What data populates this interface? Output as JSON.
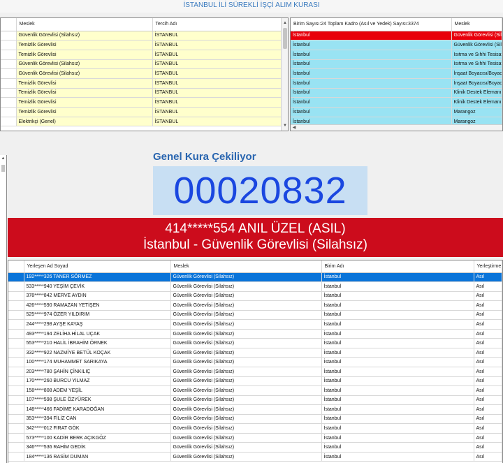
{
  "window_title": "İSTANBUL İLİ SÜREKLİ İŞÇİ ALIM KURASI",
  "top_left": {
    "columns": [
      "Meslek",
      "Tercih Adı"
    ],
    "rows": [
      [
        "Güvenlik Görevlisi (Silahsız)",
        "İSTANBUL"
      ],
      [
        "Temizlik Görevlisi",
        "İSTANBUL"
      ],
      [
        "Temizlik Görevlisi",
        "İSTANBUL"
      ],
      [
        "Güvenlik Görevlisi (Silahsız)",
        "İSTANBUL"
      ],
      [
        "Güvenlik Görevlisi (Silahsız)",
        "İSTANBUL"
      ],
      [
        "Temizlik Görevlisi",
        "İSTANBUL"
      ],
      [
        "Temizlik Görevlisi",
        "İSTANBUL"
      ],
      [
        "Temizlik Görevlisi",
        "İSTANBUL"
      ],
      [
        "Temizlik Görevlisi",
        "İSTANBUL"
      ],
      [
        "Elektrikçi (Genel)",
        "İSTANBUL"
      ]
    ]
  },
  "top_right": {
    "columns": [
      "Birim Sayısı:24 Toplam Kadro (Asıl ve Yedek) Sayısı:3374",
      "Meslek"
    ],
    "rows": [
      [
        "İstanbul",
        "Güvenlik Görevlisi (Silahsız)"
      ],
      [
        "İstanbul",
        "Güvenlik Görevlisi (Silahsız)"
      ],
      [
        "İstanbul",
        "Isıtma ve Sıhhi Tesisatçı"
      ],
      [
        "İstanbul",
        "Isıtma ve Sıhhi Tesisatçı"
      ],
      [
        "İstanbul",
        "İnşaat Boyacısı/Boyacı"
      ],
      [
        "İstanbul",
        "İnşaat Boyacısı/Boyacı"
      ],
      [
        "İstanbul",
        "Klinik Destek Elemanı (Hasta Kabul)"
      ],
      [
        "İstanbul",
        "Klinik Destek Elemanı (Hasta Kabul)"
      ],
      [
        "İstanbul",
        "Marangoz"
      ],
      [
        "İstanbul",
        "Marangoz"
      ]
    ]
  },
  "draw": {
    "label": "Genel Kura Çekiliyor",
    "number": "00020832",
    "winner_line1": "414*****554 ANIL ÜZEL (ASIL)",
    "winner_line2": "İstanbul - Güvenlik Görevlisi (Silahsız)"
  },
  "bottom_grid": {
    "columns": [
      "Yerleşen Ad Soyad",
      "Meslek",
      "Birim Adı",
      "Yerleştirme Türü"
    ],
    "rows": [
      [
        "192*****326 TANER SÖRMEZ",
        "Güvenlik Görevlisi (Silahsız)",
        "İstanbul",
        "Asıl"
      ],
      [
        "533*****940 YEŞİM ÇEVİK",
        "Güvenlik Görevlisi (Silahsız)",
        "İstanbul",
        "Asıl"
      ],
      [
        "378*****842 MERVE AYDIN",
        "Güvenlik Görevlisi (Silahsız)",
        "İstanbul",
        "Asıl"
      ],
      [
        "426*****590 RAMAZAN YETİŞEN",
        "Güvenlik Görevlisi (Silahsız)",
        "İstanbul",
        "Asıl"
      ],
      [
        "525*****974 ÖZER YILDIRIM",
        "Güvenlik Görevlisi (Silahsız)",
        "İstanbul",
        "Asıl"
      ],
      [
        "244*****298 AYŞE KAYAŞ",
        "Güvenlik Görevlisi (Silahsız)",
        "İstanbul",
        "Asıl"
      ],
      [
        "493*****194 ZELİHA HİLAL UÇAK",
        "Güvenlik Görevlisi (Silahsız)",
        "İstanbul",
        "Asıl"
      ],
      [
        "553*****210 HALİL İBRAHİM ÖRNEK",
        "Güvenlik Görevlisi (Silahsız)",
        "İstanbul",
        "Asıl"
      ],
      [
        "332*****922 NAZMİYE BETÜL KOÇAK",
        "Güvenlik Görevlisi (Silahsız)",
        "İstanbul",
        "Asıl"
      ],
      [
        "100*****174 MUHAMMET SARIKAYA",
        "Güvenlik Görevlisi (Silahsız)",
        "İstanbul",
        "Asıl"
      ],
      [
        "203*****780 ŞAHİN ÇİNKILIÇ",
        "Güvenlik Görevlisi (Silahsız)",
        "İstanbul",
        "Asıl"
      ],
      [
        "170*****260 BURCU YILMAZ",
        "Güvenlik Görevlisi (Silahsız)",
        "İstanbul",
        "Asıl"
      ],
      [
        "158*****808 ADEM YEŞİL",
        "Güvenlik Görevlisi (Silahsız)",
        "İstanbul",
        "Asıl"
      ],
      [
        "107*****598 ŞULE ÖZYÜREK",
        "Güvenlik Görevlisi (Silahsız)",
        "İstanbul",
        "Asıl"
      ],
      [
        "148*****466 FADİME KARADOĞAN",
        "Güvenlik Görevlisi (Silahsız)",
        "İstanbul",
        "Asıl"
      ],
      [
        "353*****394 FİLİZ CAN",
        "Güvenlik Görevlisi (Silahsız)",
        "İstanbul",
        "Asıl"
      ],
      [
        "342*****012 FIRAT GÖK",
        "Güvenlik Görevlisi (Silahsız)",
        "İstanbul",
        "Asıl"
      ],
      [
        "573*****100 KADİR BERK AÇIKGÖZ",
        "Güvenlik Görevlisi (Silahsız)",
        "İstanbul",
        "Asıl"
      ],
      [
        "346*****536 RAHİM GEDİK",
        "Güvenlik Görevlisi (Silahsız)",
        "İstanbul",
        "Asıl"
      ],
      [
        "184*****136 RASİM DUMAN",
        "Güvenlik Görevlisi (Silahsız)",
        "İstanbul",
        "Asıl"
      ]
    ]
  },
  "colors": {
    "title_text": "#3b7bbf",
    "left_rows_bg": "#ffffcc",
    "right_rows_bg": "#99e3f3",
    "right_selected_bg": "#e8000b",
    "number_text": "#1a47e0",
    "number_bg": "#c8dff3",
    "banner_bg": "#cc0c1c",
    "bottom_selected_bg": "#0a74d9"
  },
  "icons": [
    "scroll-up-arrow-icon",
    "scroll-down-arrow-icon",
    "scroll-left-arrow-icon",
    "scroll-right-arrow-icon"
  ]
}
